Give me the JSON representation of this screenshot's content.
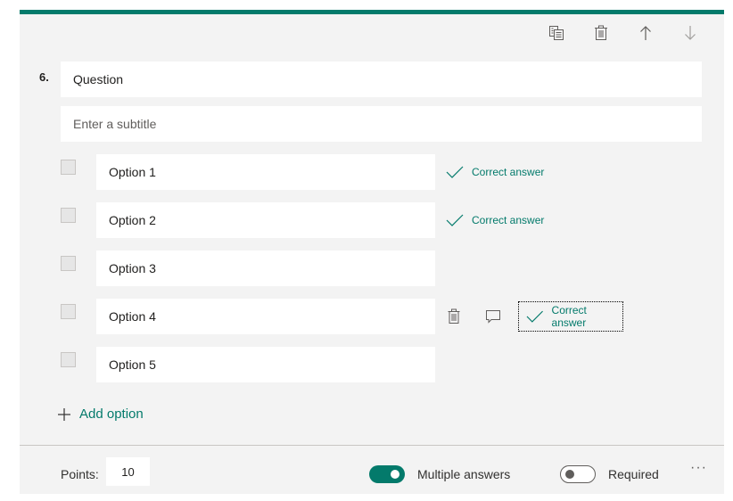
{
  "toolbar": {
    "icons": [
      "copy-question-icon",
      "delete-question-icon",
      "move-up-icon",
      "move-down-icon"
    ]
  },
  "question": {
    "number": "6.",
    "title": "Question",
    "subtitle_placeholder": "Enter a subtitle"
  },
  "options": [
    {
      "label": "Option 1",
      "correct": true,
      "correct_label": "Correct answer",
      "checked": false
    },
    {
      "label": "Option 2",
      "correct": true,
      "correct_label": "Correct answer",
      "checked": false
    },
    {
      "label": "Option 3",
      "correct": false,
      "checked": false
    },
    {
      "label": "Option 4",
      "correct": false,
      "correct_label": "Correct answer",
      "checked": false,
      "hovered": true
    },
    {
      "label": "Option 5",
      "correct": false,
      "checked": false
    }
  ],
  "add_option_label": "Add option",
  "footer": {
    "points_label": "Points:",
    "points_value": "10",
    "multiple_answers_label": "Multiple answers",
    "multiple_answers_on": true,
    "required_label": "Required",
    "required_on": false,
    "more_label": "···"
  },
  "colors": {
    "accent": "#037a6b",
    "card_bg": "#f3f3f3"
  }
}
